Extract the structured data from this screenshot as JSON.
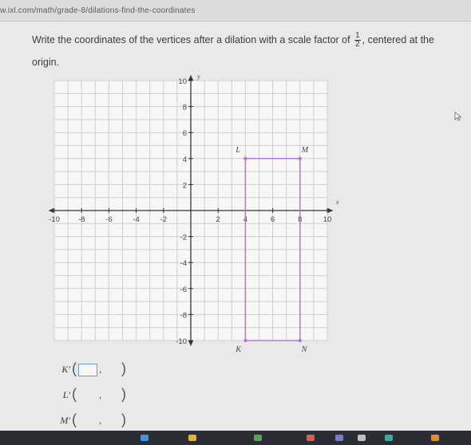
{
  "browser": {
    "url": "w.ixl.com/math/grade-8/dilations-find-the-coordinates"
  },
  "question": {
    "text_before": "Write the coordinates of the vertices after a dilation with a scale factor of",
    "scale_numerator": "1",
    "scale_denominator": "2",
    "text_after": ", centered at the origin."
  },
  "graph": {
    "x_axis_label": "x",
    "y_axis_label": "y",
    "axis_range": [
      -10,
      10
    ],
    "tick_labels_x": [
      "-10",
      "-8",
      "-6",
      "-4",
      "-2",
      "2",
      "4",
      "6",
      "8",
      "10"
    ],
    "tick_labels_y": [
      "10",
      "8",
      "6",
      "4",
      "2",
      "-2",
      "-4",
      "-6",
      "-8",
      "-10"
    ],
    "grid": true,
    "rectangle_color": "#b27ad6",
    "vertices": [
      {
        "label": "L",
        "x": 4,
        "y": 4
      },
      {
        "label": "M",
        "x": 8,
        "y": 4
      },
      {
        "label": "N",
        "x": 8,
        "y": -10
      },
      {
        "label": "K",
        "x": 4,
        "y": -10
      }
    ]
  },
  "answers": [
    {
      "label": "K′",
      "x_value": "",
      "y_value": "",
      "focused": "x"
    },
    {
      "label": "L′",
      "x_value": "",
      "y_value": ""
    },
    {
      "label": "M′",
      "x_value": "",
      "y_value": ""
    }
  ],
  "taskbar": {
    "icon_colors": [
      "#4a90d9",
      "#e0b040",
      "#5aa05a",
      "#d06060",
      "#7a7acc",
      "#c0c0c0",
      "#3fa9a0",
      "#e08a3c"
    ]
  }
}
